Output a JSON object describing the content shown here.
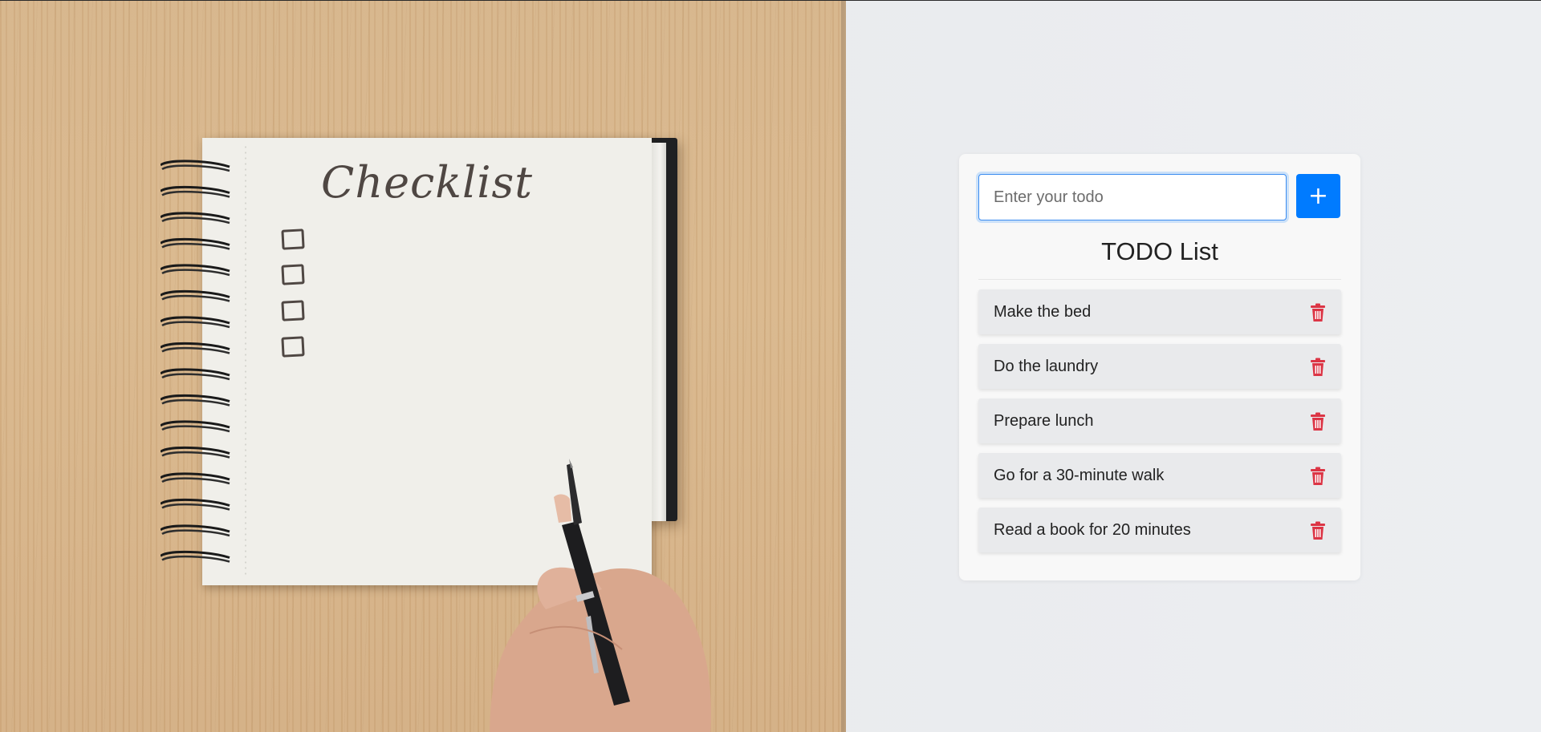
{
  "todo_app": {
    "input": {
      "placeholder": "Enter your todo",
      "value": ""
    },
    "add_button_label": "+",
    "list_title": "TODO List",
    "items": [
      {
        "text": "Make the bed",
        "delete_icon": "trash-icon"
      },
      {
        "text": "Do the laundry",
        "delete_icon": "trash-icon"
      },
      {
        "text": "Prepare lunch",
        "delete_icon": "trash-icon"
      },
      {
        "text": "Go for a 30-minute walk",
        "delete_icon": "trash-icon"
      },
      {
        "text": "Read a book for 20 minutes",
        "delete_icon": "trash-icon"
      }
    ]
  },
  "hero_image": {
    "notebook_heading": "Checklist"
  },
  "colors": {
    "accent": "#007bff",
    "delete": "#dc3545",
    "card_background": "#f8f8f8",
    "item_background": "#e9eaec"
  }
}
